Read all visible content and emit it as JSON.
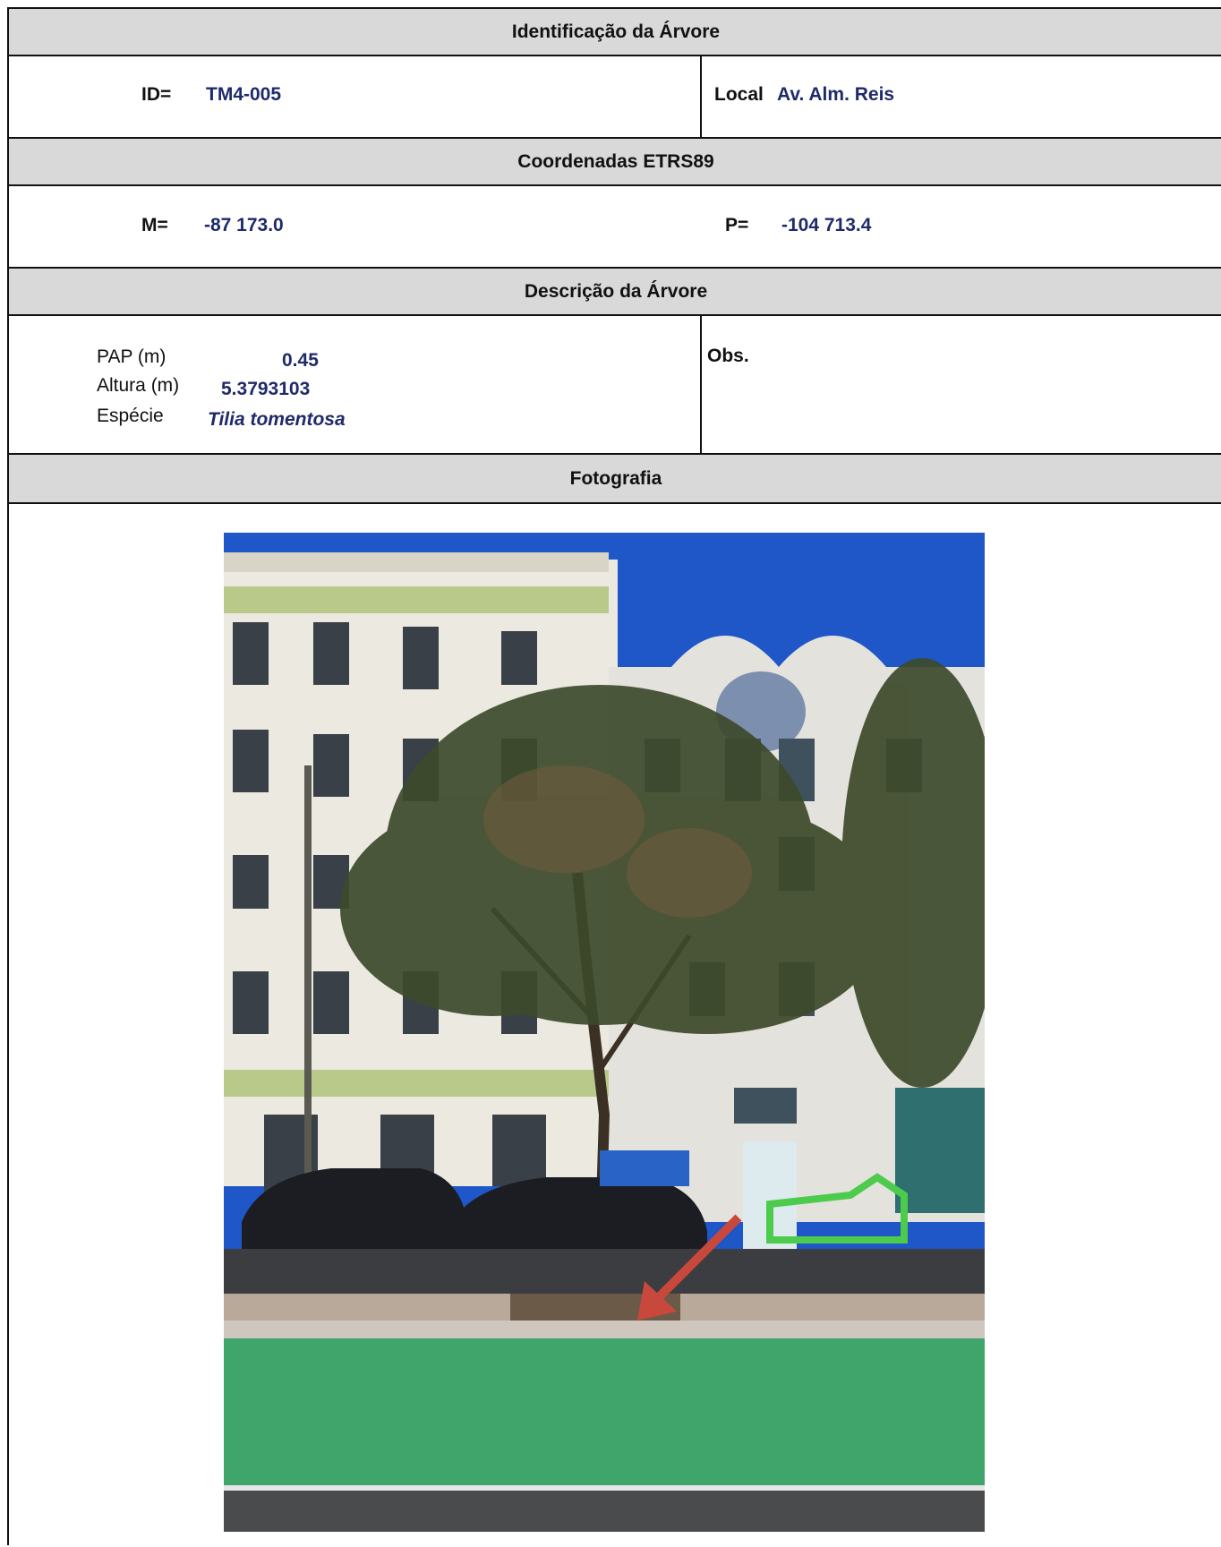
{
  "identificacao": {
    "header": "Identificação da Árvore",
    "id_label": "ID=",
    "id_value": "TM4-005",
    "local_label": "Local",
    "local_value": "Av. Alm. Reis"
  },
  "coordenadas": {
    "header": "Coordenadas ETRS89",
    "m_label": "M=",
    "m_value": "-87 173.0",
    "p_label": "P=",
    "p_value": "-104 713.4"
  },
  "descricao": {
    "header": "Descrição da Árvore",
    "pap_label": "PAP (m)",
    "pap_value": "0.45",
    "altura_label": "Altura (m)",
    "altura_value": "5.3793103",
    "especie_label": "Espécie",
    "especie_value": "Tilia tomentosa",
    "obs_label": "Obs."
  },
  "fotografia": {
    "header": "Fotografia"
  },
  "colors": {
    "header_bg": "#d9d9d9",
    "value_text": "#1f2a6b",
    "bike_lane": "#3fa56a",
    "sky": "#1f56c8",
    "arrow": "#c8483c"
  }
}
